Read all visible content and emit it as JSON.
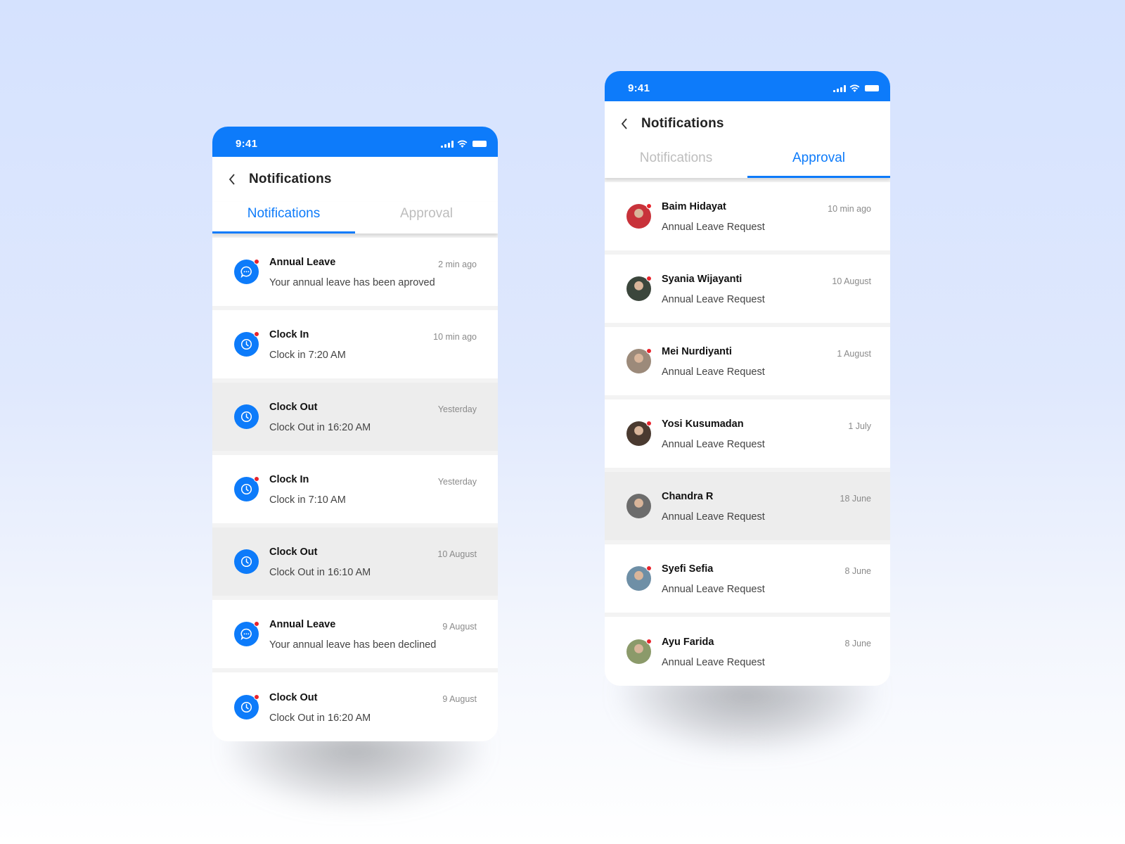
{
  "theme": {
    "accent": "#0d7bfa",
    "badge": "#e8232b",
    "read_bg": "#ededed"
  },
  "left_screen": {
    "status_time": "9:41",
    "status_icons": [
      "signal-icon",
      "wifi-icon",
      "battery-icon"
    ],
    "header_title": "Notifications",
    "tabs": [
      {
        "label": "Notifications",
        "active": true
      },
      {
        "label": "Approval",
        "active": false
      }
    ],
    "items": [
      {
        "icon": "chat-bubble-icon",
        "title": "Annual Leave",
        "subtitle": "Your annual leave has been aproved",
        "time": "2 min ago",
        "unread": true
      },
      {
        "icon": "clock-icon",
        "title": "Clock In",
        "subtitle": "Clock in 7:20 AM",
        "time": "10 min ago",
        "unread": true
      },
      {
        "icon": "clock-icon",
        "title": "Clock Out",
        "subtitle": "Clock Out in 16:20 AM",
        "time": "Yesterday",
        "unread": false
      },
      {
        "icon": "clock-icon",
        "title": "Clock In",
        "subtitle": "Clock in 7:10 AM",
        "time": "Yesterday",
        "unread": true
      },
      {
        "icon": "clock-icon",
        "title": "Clock Out",
        "subtitle": "Clock Out in 16:10 AM",
        "time": "10 August",
        "unread": false
      },
      {
        "icon": "chat-bubble-icon",
        "title": "Annual Leave",
        "subtitle": "Your annual leave has been declined",
        "time": "9 August",
        "unread": true
      },
      {
        "icon": "clock-icon",
        "title": "Clock Out",
        "subtitle": "Clock Out in 16:20 AM",
        "time": "9 August",
        "unread": true
      }
    ]
  },
  "right_screen": {
    "status_time": "9:41",
    "status_icons": [
      "signal-icon",
      "wifi-icon",
      "battery-icon"
    ],
    "header_title": "Notifications",
    "tabs": [
      {
        "label": "Notifications",
        "active": false
      },
      {
        "label": "Approval",
        "active": true
      }
    ],
    "items": [
      {
        "name": "Baim Hidayat",
        "subtitle": "Annual Leave Request",
        "time": "10 min ago",
        "unread": true,
        "avatar_color": "#c8323a"
      },
      {
        "name": "Syania Wijayanti",
        "subtitle": "Annual Leave Request",
        "time": "10 August",
        "unread": true,
        "avatar_color": "#3b463c"
      },
      {
        "name": "Mei Nurdiyanti",
        "subtitle": "Annual Leave Request",
        "time": "1 August",
        "unread": true,
        "avatar_color": "#9c8a7a"
      },
      {
        "name": "Yosi Kusumadan",
        "subtitle": "Annual Leave Request",
        "time": "1 July",
        "unread": true,
        "avatar_color": "#4a3a30"
      },
      {
        "name": "Chandra R",
        "subtitle": "Annual Leave Request",
        "time": "18 June",
        "unread": false,
        "avatar_color": "#6c6c6c"
      },
      {
        "name": "Syefi Sefia",
        "subtitle": "Annual Leave Request",
        "time": "8 June",
        "unread": true,
        "avatar_color": "#6e8fa6"
      },
      {
        "name": "Ayu Farida",
        "subtitle": "Annual Leave Request",
        "time": "8 June",
        "unread": true,
        "avatar_color": "#8b9a6a"
      }
    ]
  }
}
